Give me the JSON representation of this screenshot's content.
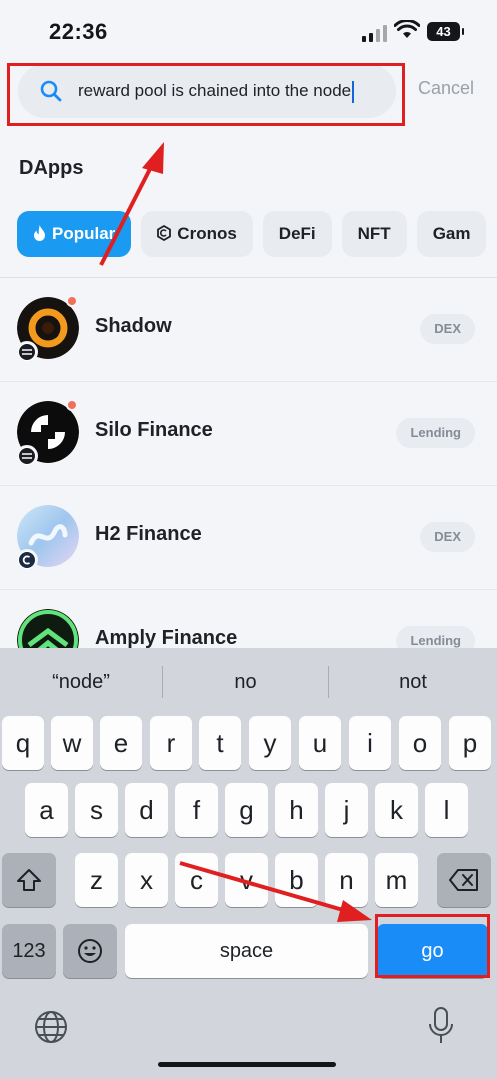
{
  "status_bar": {
    "time": "22:36",
    "battery": "43"
  },
  "search": {
    "query": "reward pool is chained into the node",
    "cancel_label": "Cancel"
  },
  "section": {
    "title": "DApps"
  },
  "categories": [
    {
      "label": "Popular",
      "active": true,
      "icon": "flame-icon"
    },
    {
      "label": "Cronos",
      "active": false,
      "icon": "cronos-icon"
    },
    {
      "label": "DeFi",
      "active": false
    },
    {
      "label": "NFT",
      "active": false
    },
    {
      "label": "Gam",
      "active": false
    }
  ],
  "dapps": [
    {
      "name": "Shadow",
      "tag": "DEX",
      "chain_badge": "sonic",
      "notification_dot": true
    },
    {
      "name": "Silo Finance",
      "tag": "Lending",
      "chain_badge": "sonic",
      "notification_dot": true
    },
    {
      "name": "H2 Finance",
      "tag": "DEX",
      "chain_badge": "cronos",
      "notification_dot": false
    },
    {
      "name": "Amply Finance",
      "tag": "Lending",
      "chain_badge": "cronos",
      "notification_dot": false
    }
  ],
  "keyboard": {
    "suggestions": [
      "“node”",
      "no",
      "not"
    ],
    "row1": [
      "q",
      "w",
      "e",
      "r",
      "t",
      "y",
      "u",
      "i",
      "o",
      "p"
    ],
    "row2": [
      "a",
      "s",
      "d",
      "f",
      "g",
      "h",
      "j",
      "k",
      "l"
    ],
    "row3": [
      "z",
      "x",
      "c",
      "v",
      "b",
      "n",
      "m"
    ],
    "numbers_label": "123",
    "space_label": "space",
    "go_label": "go"
  },
  "colors": {
    "accent": "#1a9af0",
    "go_key": "#1a8cf8",
    "highlight": "#e02020"
  }
}
